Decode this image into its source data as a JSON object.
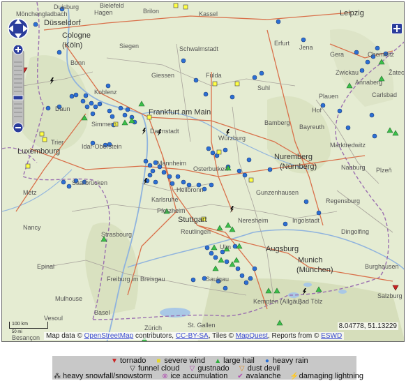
{
  "map": {
    "places": [
      {
        "name": "Duisburg",
        "type": "city"
      },
      {
        "name": "Hagen",
        "type": "city"
      },
      {
        "name": "Brilon",
        "type": "city"
      },
      {
        "name": "Kassel",
        "type": "city"
      },
      {
        "name": "Leipzig",
        "type": "big"
      },
      {
        "name": "Düsseldorf",
        "type": "big"
      },
      {
        "name": "Cologne",
        "type": "big"
      },
      {
        "name": "(Köln)",
        "type": "big"
      },
      {
        "name": "Siegen",
        "type": "city"
      },
      {
        "name": "Schwalmstadt",
        "type": "city"
      },
      {
        "name": "Erfurt",
        "type": "city"
      },
      {
        "name": "Jena",
        "type": "city"
      },
      {
        "name": "Gera",
        "type": "city"
      },
      {
        "name": "Bonn",
        "type": "city"
      },
      {
        "name": "Chemnitz",
        "type": "city"
      },
      {
        "name": "Zwickau",
        "type": "city"
      },
      {
        "name": "Giessen",
        "type": "city"
      },
      {
        "name": "Fulda",
        "type": "city"
      },
      {
        "name": "Suhl",
        "type": "city"
      },
      {
        "name": "Koblenz",
        "type": "city"
      },
      {
        "name": "Frankfurt am Main",
        "type": "big"
      },
      {
        "name": "Plauen",
        "type": "city"
      },
      {
        "name": "Daun",
        "type": "city"
      },
      {
        "name": "Hof",
        "type": "city"
      },
      {
        "name": "Simmern",
        "type": "city"
      },
      {
        "name": "Bamberg",
        "type": "city"
      },
      {
        "name": "Carlsbad",
        "type": "city"
      },
      {
        "name": "Darmstadt",
        "type": "city"
      },
      {
        "name": "Bayreuth",
        "type": "city"
      },
      {
        "name": "Trier",
        "type": "city"
      },
      {
        "name": "Idar-Oberstein",
        "type": "city"
      },
      {
        "name": "Würzburg",
        "type": "city"
      },
      {
        "name": "Marktredwitz",
        "type": "city"
      },
      {
        "name": "Luxembourg",
        "type": "big"
      },
      {
        "name": "Nuremberg",
        "type": "big"
      },
      {
        "name": "(Nürnberg)",
        "type": "big"
      },
      {
        "name": "Mannheim",
        "type": "city"
      },
      {
        "name": "Osterburken",
        "type": "city"
      },
      {
        "name": "Saarbrücken",
        "type": "city"
      },
      {
        "name": "Heilbronn",
        "type": "city"
      },
      {
        "name": "Gunzenhausen",
        "type": "city"
      },
      {
        "name": "Nabburg",
        "type": "city"
      },
      {
        "name": "Metz",
        "type": "city"
      },
      {
        "name": "Karlsruhe",
        "type": "city"
      },
      {
        "name": "Regensburg",
        "type": "city"
      },
      {
        "name": "Pforzheim",
        "type": "city"
      },
      {
        "name": "Ingolstadt",
        "type": "city"
      },
      {
        "name": "Nancy",
        "type": "city"
      },
      {
        "name": "Stuttgart",
        "type": "big"
      },
      {
        "name": "Neresheim",
        "type": "city"
      },
      {
        "name": "Strasbourg",
        "type": "city"
      },
      {
        "name": "Reutlingen",
        "type": "city"
      },
      {
        "name": "Dingolfing",
        "type": "city"
      },
      {
        "name": "Augsburg",
        "type": "city"
      },
      {
        "name": "Ulm",
        "type": "city"
      },
      {
        "name": "Epinal",
        "type": "city"
      },
      {
        "name": "Munich",
        "type": "big"
      },
      {
        "name": "(München)",
        "type": "big"
      },
      {
        "name": "Burghausen",
        "type": "city"
      },
      {
        "name": "Freiburg im Breisgau",
        "type": "city"
      },
      {
        "name": "Saulgau",
        "type": "city"
      },
      {
        "name": "Mulhouse",
        "type": "city"
      },
      {
        "name": "Kempten (Allgäu)",
        "type": "city"
      },
      {
        "name": "Bad Tölz",
        "type": "city"
      },
      {
        "name": "Basel",
        "type": "city"
      },
      {
        "name": "Salzburg",
        "type": "city"
      },
      {
        "name": "Zürich",
        "type": "city"
      },
      {
        "name": "St. Gallen",
        "type": "city"
      },
      {
        "name": "Vesoul",
        "type": "city"
      },
      {
        "name": "Besançon",
        "type": "city"
      },
      {
        "name": "Bielefeld",
        "type": "city"
      },
      {
        "name": "Mönchengladbach",
        "type": "city"
      },
      {
        "name": "Annaberg",
        "type": "city"
      },
      {
        "name": "Plzeň",
        "type": "city"
      },
      {
        "name": "Žatec",
        "type": "city"
      }
    ],
    "scale_label": "100 km",
    "scale_sub": "50 mi",
    "coordinates": "8.04778, 51.13229",
    "attribution": {
      "prefix": "Map data ©",
      "osm_link": "OpenStreetMap",
      "mid1": "contributors,",
      "license_link": "CC-BY-SA",
      "mid2": ", Tiles ©",
      "tiles_link": "MapQuest",
      "mid3": ", Reports from ©",
      "eswd_link": "ESWD"
    },
    "colors": {
      "heavy_rain": "#2b6fd4",
      "large_hail": "#22b45a",
      "severe_wind": "#ffff44",
      "tornado": "#cc2222",
      "lightning": "#111111"
    }
  },
  "legend": {
    "row1": [
      {
        "symbol": "▼",
        "color": "#cc2222",
        "label": "tornado"
      },
      {
        "symbol": "■",
        "color": "#f2e53a",
        "label": "severe wind"
      },
      {
        "symbol": "▲",
        "color": "#2fae3e",
        "label": "large hail"
      },
      {
        "symbol": "●",
        "color": "#2b6fd4",
        "label": "heavy rain"
      }
    ],
    "row2": [
      {
        "symbol": "▽",
        "color": "#222222",
        "label": "funnel cloud"
      },
      {
        "symbol": "▽",
        "color": "#b04ab0",
        "label": "gustnado"
      },
      {
        "symbol": "▽",
        "color": "#e08a20",
        "label": "dust devil"
      }
    ],
    "row3": [
      {
        "symbol": "⁂",
        "color": "#222222",
        "label": "heavy snowfall/snowstorm"
      },
      {
        "symbol": "⊗",
        "color": "#b04ab0",
        "label": "ice accumulation"
      },
      {
        "symbol": "✔",
        "color": "#b04ab0",
        "label": "avalanche"
      },
      {
        "symbol": "⚡",
        "color": "#222222",
        "label": "damaging lightning"
      }
    ]
  }
}
